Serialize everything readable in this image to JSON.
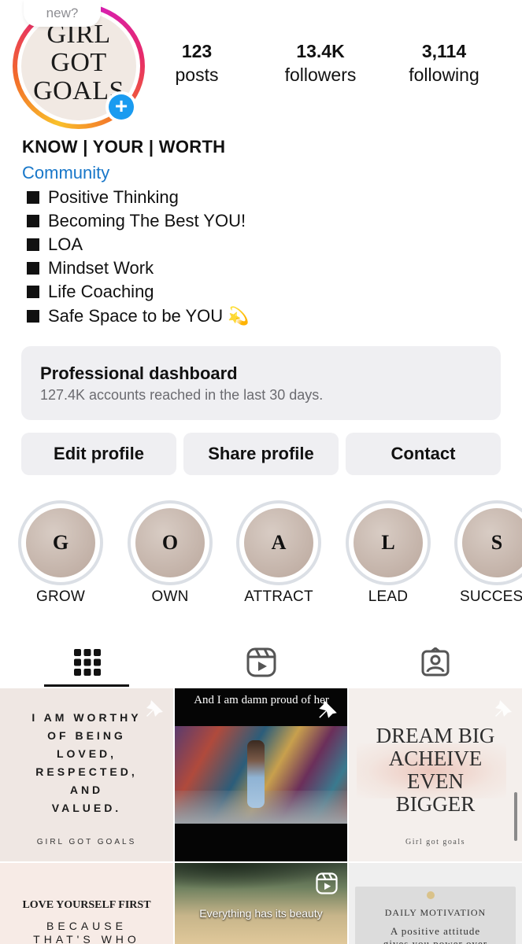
{
  "profile": {
    "note": "new?",
    "avatar_text": [
      "GIRL",
      "GOT",
      "GOALS"
    ],
    "stats": [
      {
        "value": "123",
        "label": "posts"
      },
      {
        "value": "13.4K",
        "label": "followers"
      },
      {
        "value": "3,114",
        "label": "following"
      }
    ],
    "name": "KNOW | YOUR | WORTH",
    "category": "Community",
    "bio": [
      "Positive Thinking",
      "Becoming The Best YOU!",
      "LOA",
      "Mindset Work",
      "Life Coaching",
      "Safe Space to be YOU 💫"
    ]
  },
  "dashboard": {
    "title": "Professional dashboard",
    "subtitle": "127.4K accounts reached in the last 30 days."
  },
  "buttons": {
    "edit": "Edit profile",
    "share": "Share profile",
    "contact": "Contact"
  },
  "highlights": [
    {
      "letter": "G",
      "label": "GROW"
    },
    {
      "letter": "O",
      "label": "OWN"
    },
    {
      "letter": "A",
      "label": "ATTRACT"
    },
    {
      "letter": "L",
      "label": "LEAD"
    },
    {
      "letter": "S",
      "label": "SUCCES"
    }
  ],
  "tabs": [
    "grid-icon",
    "reels-icon",
    "tagged-icon"
  ],
  "posts": [
    {
      "lines": [
        "I AM WORTHY",
        "OF BEING",
        "LOVED,",
        "RESPECTED,",
        "AND",
        "VALUED."
      ],
      "footer": "GIRL GOT GOALS"
    },
    {
      "caption": "And I am damn proud of her"
    },
    {
      "lines": [
        "DREAM BIG",
        "ACHEIVE",
        "EVEN",
        "BIGGER"
      ],
      "footer": "Girl got goals"
    },
    {
      "lines": [
        "LOVE YOURSELF FIRST",
        "BECAUSE",
        "THAT'S WHO"
      ]
    },
    {
      "caption": "Everything has its beauty"
    },
    {
      "lines": [
        "DAILY MOTIVATION",
        "A positive attitude",
        "gives you power over"
      ]
    }
  ],
  "colors": {
    "accent": "#1877c9",
    "story_blue": "#1a9bf0",
    "button_bg": "#efeff2"
  }
}
